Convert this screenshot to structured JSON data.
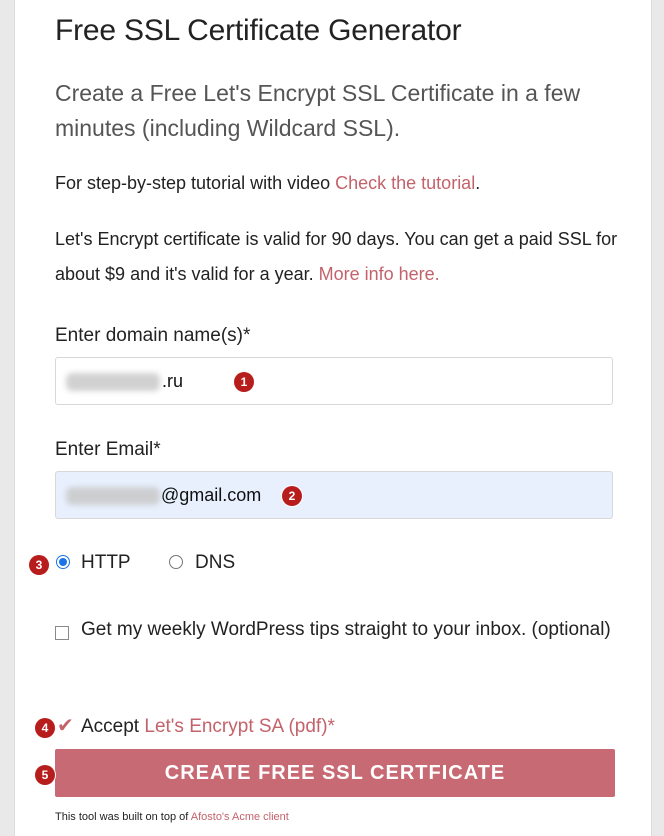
{
  "header": {
    "title": "Free SSL Certificate Generator",
    "subtitle": "Create a Free Let's Encrypt SSL Certificate in a few minutes (including Wildcard SSL)."
  },
  "intro": {
    "tutorial_text": "For step-by-step tutorial with video ",
    "tutorial_link": "Check the tutorial",
    "tutorial_end": ".",
    "validity_text": "Let's Encrypt certificate is valid for 90 days. You can get a paid SSL for about $9 and it's valid for a year. ",
    "more_info_link": "More info here."
  },
  "form": {
    "domain_label": "Enter domain name(s)*",
    "domain_value_suffix": ".ru",
    "email_label": "Enter Email*",
    "email_value_suffix": "@gmail.com",
    "verification": {
      "options": [
        "HTTP",
        "DNS"
      ],
      "selected": "HTTP"
    },
    "wp_tips_label": "Get my weekly WordPress tips straight to your inbox. (optional)",
    "accept_prefix": "Accept ",
    "accept_link": "Let's Encrypt SA (pdf)*",
    "submit_label": "CREATE FREE SSL CERTFICATE"
  },
  "footer": {
    "text": "This tool was built on top of ",
    "link": "Afosto's Acme client"
  },
  "markers": [
    "1",
    "2",
    "3",
    "4",
    "5"
  ],
  "colors": {
    "accent": "#c4626b",
    "button": "#c86a73",
    "marker": "#b81d1d",
    "radio_checked": "#1a73e8"
  }
}
